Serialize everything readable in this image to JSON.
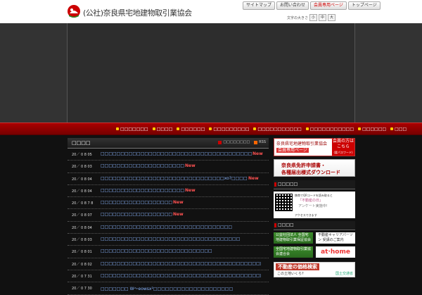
{
  "header": {
    "site_title": "(公社)奈良県宅地建物取引業協会",
    "util_nav": [
      {
        "label": "サイトマップ"
      },
      {
        "label": "お問い合わせ"
      },
      {
        "label": "会員専用ページ"
      },
      {
        "label": "トップページ"
      }
    ],
    "font_size_label": "文字の大きさ",
    "font_sizes": [
      "小",
      "中",
      "大"
    ]
  },
  "global_nav": [
    "□□□□□□□",
    "□□□□",
    "□□□□□□",
    "□□□□□□□□□",
    "□□□□□□□□□□□",
    "□□□□□□□□□□□",
    "□□□□□□",
    "□□□"
  ],
  "news": {
    "title": "□□□□",
    "list_link": "□□□□□□□□",
    "rss_label": "RSS",
    "new_label": "New",
    "items": [
      {
        "date": "20／ 0 8 05",
        "text": "□□□□□□□□□□□□□□□□□□□□□□□□□□□□□□□□□□□□□□",
        "new": true
      },
      {
        "date": "20／ 0 8 03",
        "text": "□□□□□□□□□□□□□□□□□□□□□",
        "new": true
      },
      {
        "date": "20／ 0 8 04",
        "text": "□□□□□□□□□□□□□□□□□□□□□□□□□□□□□□□xo?□□□□",
        "new": true
      },
      {
        "date": "20／ 0 8 04",
        "text": "□□□□□□□□□□□□□□□□□□□□□",
        "new": true
      },
      {
        "date": "20／ 0 8 7 8",
        "text": "□□□□□□□□□□□□□□□□□□",
        "new": true
      },
      {
        "date": "20／ 0 8 07",
        "text": "□□□□□□□□□□□□□□□□□□",
        "new": true
      },
      {
        "date": "20／ 0 8 04",
        "text": "□□□□□□□□□□□□□□□□□□□□□□□□□□□□□□□□□",
        "new": false
      },
      {
        "date": "20／ 0 8 03",
        "text": "□□□□□□□□□□□□□□□□□□□□□□□□□□□□□□□□□□□",
        "new": false
      },
      {
        "date": "20／ 0 8 01",
        "text": "□□□□□□□□□□□□□□□□□□□□□□□□□□□□",
        "new": false
      },
      {
        "date": "20／ 0 8 02",
        "text": "□□□□□□□□□□□□□□□□□□□□□□□□□□□□□□□□□□□□□□□□□□□□□□□□□□□□",
        "new": false
      },
      {
        "date": "20／ 0 7 31",
        "text": "□□□□□□□□□□□□□□□□□□□□□□□□□□□□□□□□□□□□□□□□□□□□□□□□□",
        "new": false
      },
      {
        "date": "20／ 0 7 30",
        "text": "□□□□□□□ W～eowsx²□□□□□□□□□□□□□□□□□□□□",
        "new": false
      }
    ]
  },
  "sidebar": {
    "member_banner_left": [
      "奈良県宅地建物取引業協会",
      "会員専用ページ"
    ],
    "member_banner_right": [
      "会員の方は",
      "こちら",
      "(要パスワード)"
    ],
    "download_banner": [
      "奈良県免許申請書・",
      "各種届出様式ダウンロード"
    ],
    "heading1": "□□□□□",
    "qr_text": [
      "携帯でQRコードを読み取ると",
      "アクセスできます"
    ],
    "fudosan_day": "「不動産の日」",
    "fudosan_sub": "アンケート実施中!",
    "heading2": "□□□□",
    "banners": [
      {
        "left": "公益社団法人 全国宅地建物取引業保証協会",
        "right": "不動産キャリアパーソン 受講のご案内"
      },
      {
        "left": "全国宅地建物取引業協会連合会",
        "right": "at·home"
      }
    ],
    "price_banner": "不動産の価格検索",
    "price_sub": "この土地いくら?",
    "price_mark": "国土交通省"
  },
  "colors": {
    "accent": "#aa0000",
    "link": "#8ab6ff",
    "new_badge": "#ff5252"
  }
}
